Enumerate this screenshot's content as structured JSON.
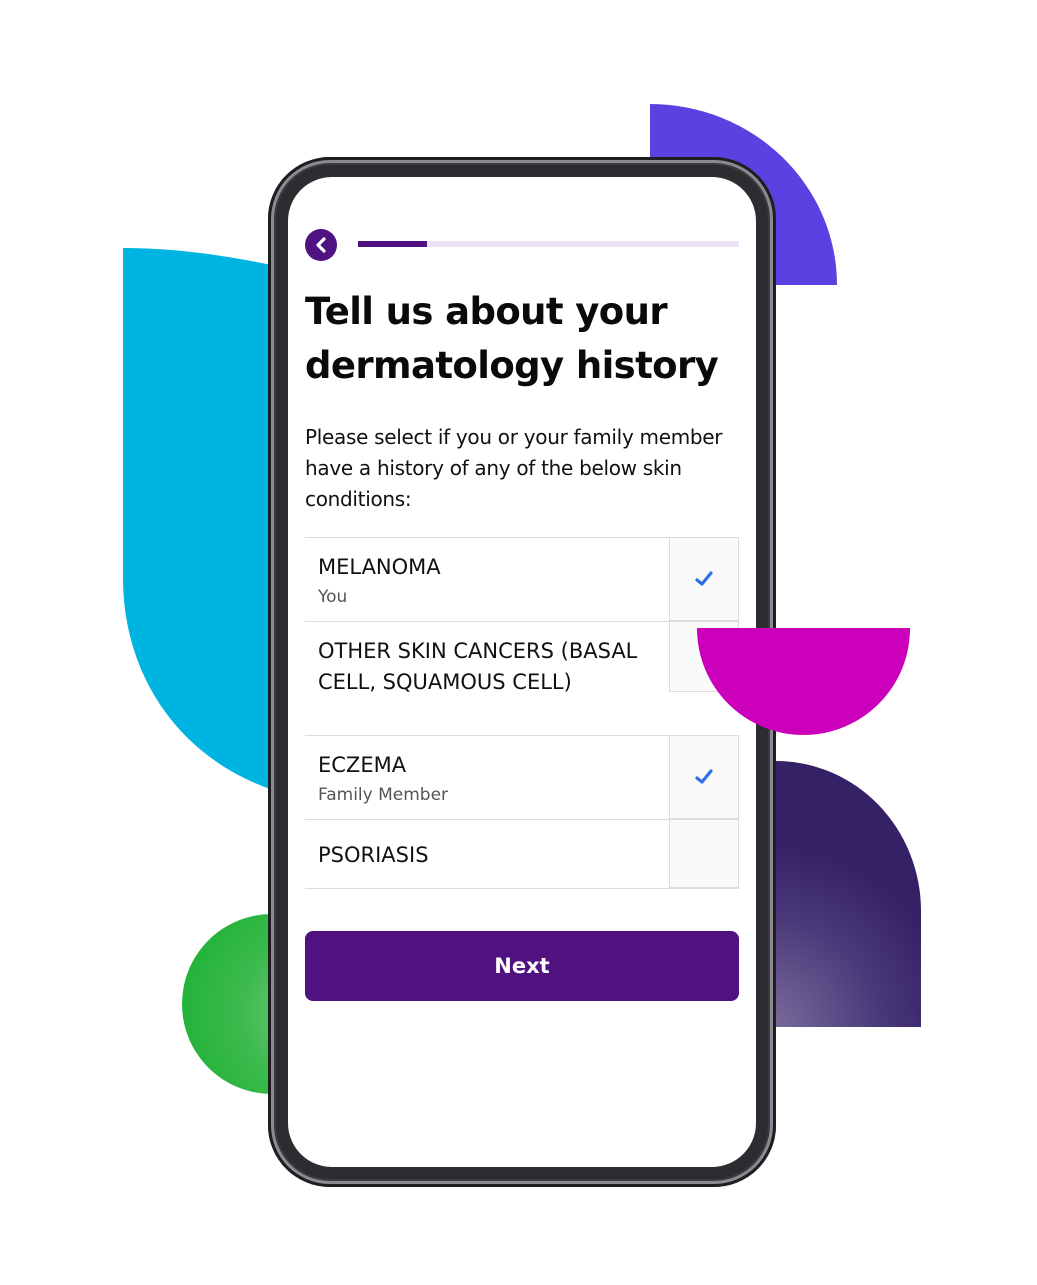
{
  "header": {
    "back_icon": "chevron-left-icon",
    "progress_fraction": 0.18
  },
  "title": "Tell us about your dermatology history",
  "subtitle": "Please select if you or your family member have a history of any of the below skin conditions:",
  "conditions": [
    {
      "label": "MELANOMA",
      "sub": "You",
      "checked": true
    },
    {
      "label": "OTHER SKIN CANCERS (BASAL CELL, SQUAMOUS CELL)",
      "sub": "",
      "checked": false
    },
    {
      "label": "ECZEMA",
      "sub": "Family Member",
      "checked": true
    },
    {
      "label": "PSORIASIS",
      "sub": "",
      "checked": false
    }
  ],
  "next_label": "Next",
  "colors": {
    "brand_purple": "#511281",
    "check_blue": "#2f6fe8",
    "progress_track": "#ece4f4",
    "deco_cyan": "#00b4e1",
    "deco_violet": "#5b40e2",
    "deco_magenta": "#cc00bb",
    "deco_indigo": "#352165",
    "deco_green": "#16b02e"
  }
}
